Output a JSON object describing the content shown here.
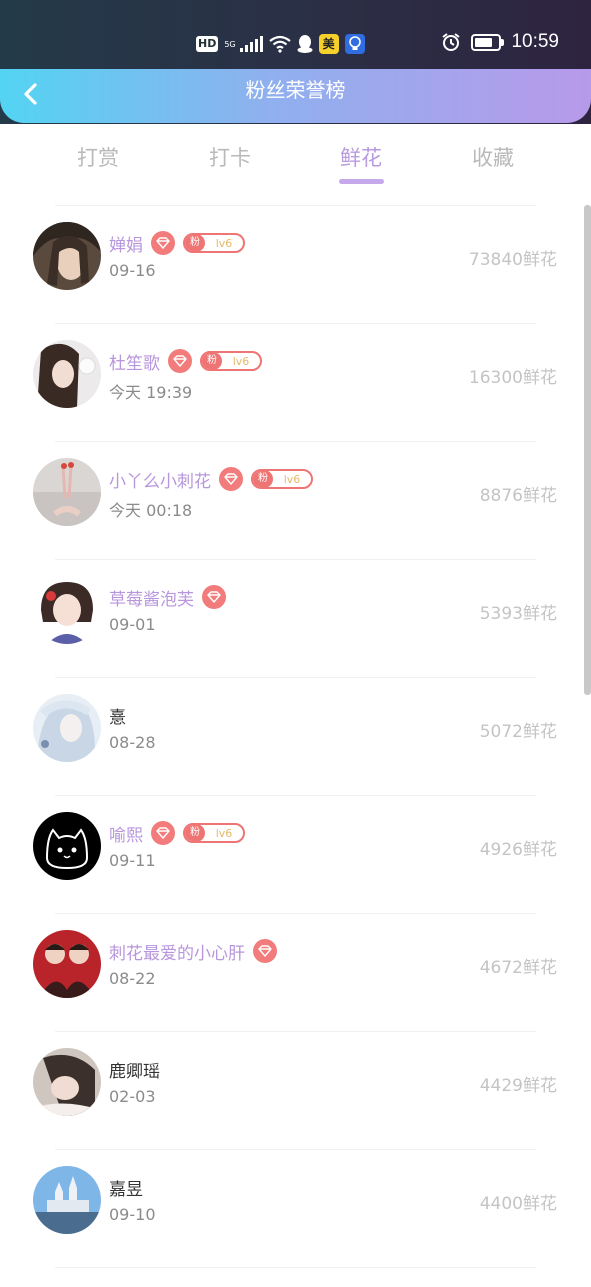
{
  "status_bar": {
    "network": "HD",
    "gen": "5G",
    "app1": "美",
    "time": "10:59",
    "battery_level": 0.75
  },
  "header": {
    "title": "粉丝荣誉榜"
  },
  "tabs": [
    {
      "label": "打赏"
    },
    {
      "label": "打卡"
    },
    {
      "label": "鲜花",
      "active": true
    },
    {
      "label": "收藏"
    }
  ],
  "fan_badge": {
    "key": "粉",
    "level": "lv6"
  },
  "rows": [
    {
      "name": "婵娟",
      "date": "09-16",
      "value": "73840鲜花"
    },
    {
      "name": "杜笙歌",
      "date": "今天 19:39",
      "value": "16300鲜花"
    },
    {
      "name": "小丫么小刺花",
      "date": "今天 00:18",
      "value": "8876鲜花"
    },
    {
      "name": "草莓酱泡芙",
      "date": "09-01",
      "value": "5393鲜花"
    },
    {
      "name": "憙",
      "date": "08-28",
      "value": "5072鲜花"
    },
    {
      "name": "喻熙",
      "date": "09-11",
      "value": "4926鲜花"
    },
    {
      "name": "刺花最爱的小心肝",
      "date": "08-22",
      "value": "4672鲜花"
    },
    {
      "name": "鹿卿瑶",
      "date": "02-03",
      "value": "4429鲜花"
    },
    {
      "name": "嘉昱",
      "date": "09-10",
      "value": "4400鲜花"
    }
  ]
}
